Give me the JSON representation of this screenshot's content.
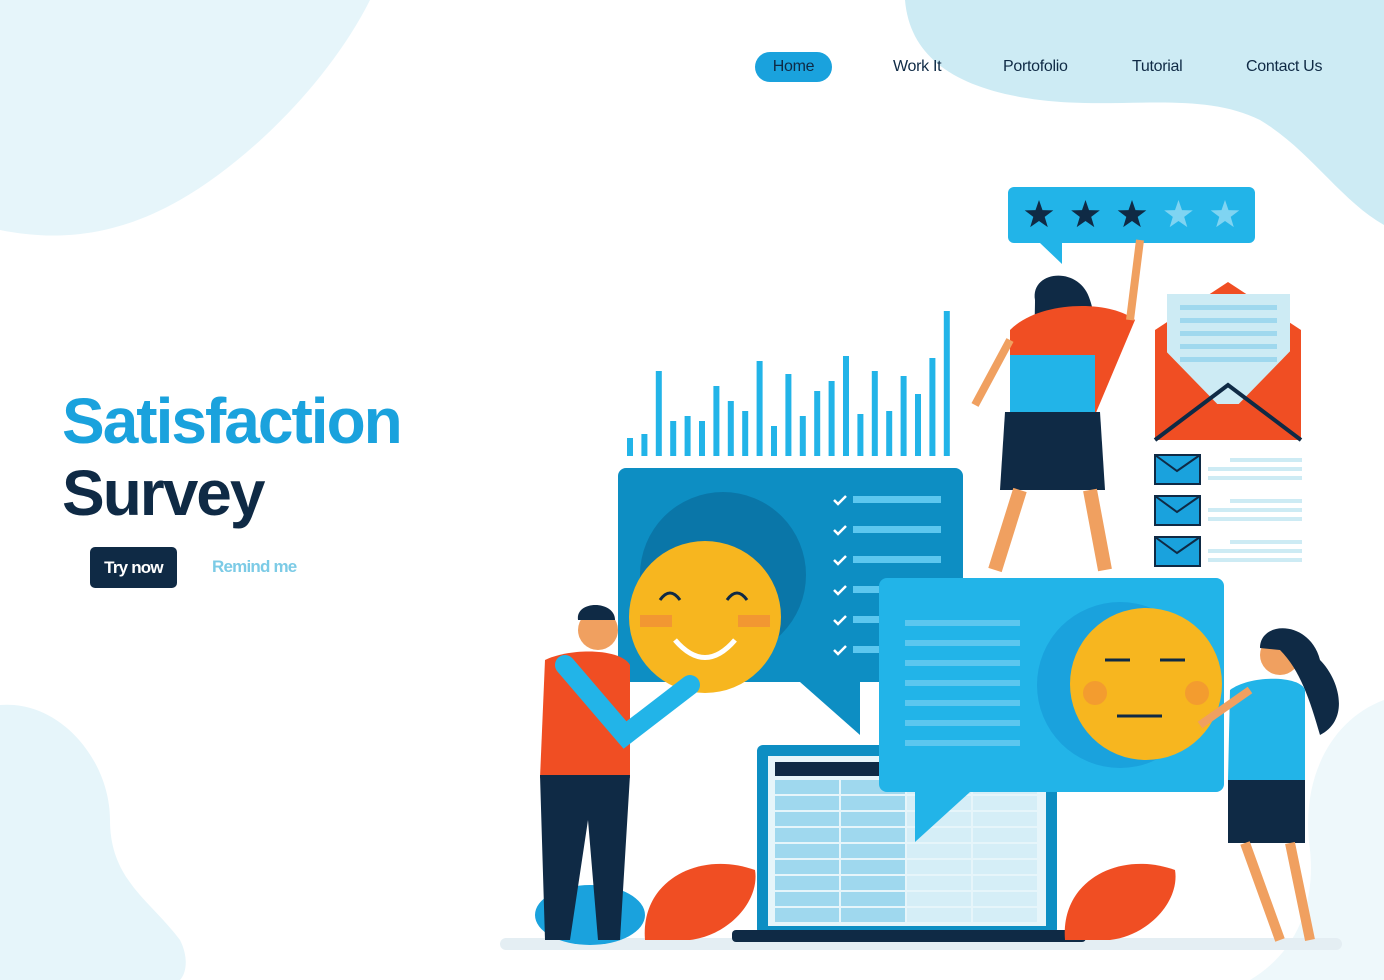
{
  "nav": {
    "items": [
      {
        "label": "Home",
        "active": true
      },
      {
        "label": "Work It"
      },
      {
        "label": "Portofolio"
      },
      {
        "label": "Tutorial"
      },
      {
        "label": "Contact Us"
      }
    ]
  },
  "hero": {
    "title_line1": "Satisfaction",
    "title_line2": "Survey",
    "primary_button": "Try now",
    "secondary_link": "Remind me"
  },
  "illustration": {
    "rating_stars_filled": 3,
    "rating_stars_total": 5,
    "happy_emoji": "smiling-face",
    "neutral_emoji": "unamused-face"
  },
  "colors": {
    "accent": "#1aa2dd",
    "navy": "#0f2a45",
    "light_blue": "#cdebf4",
    "orange": "#f04e23",
    "yellow": "#f7b61f"
  }
}
